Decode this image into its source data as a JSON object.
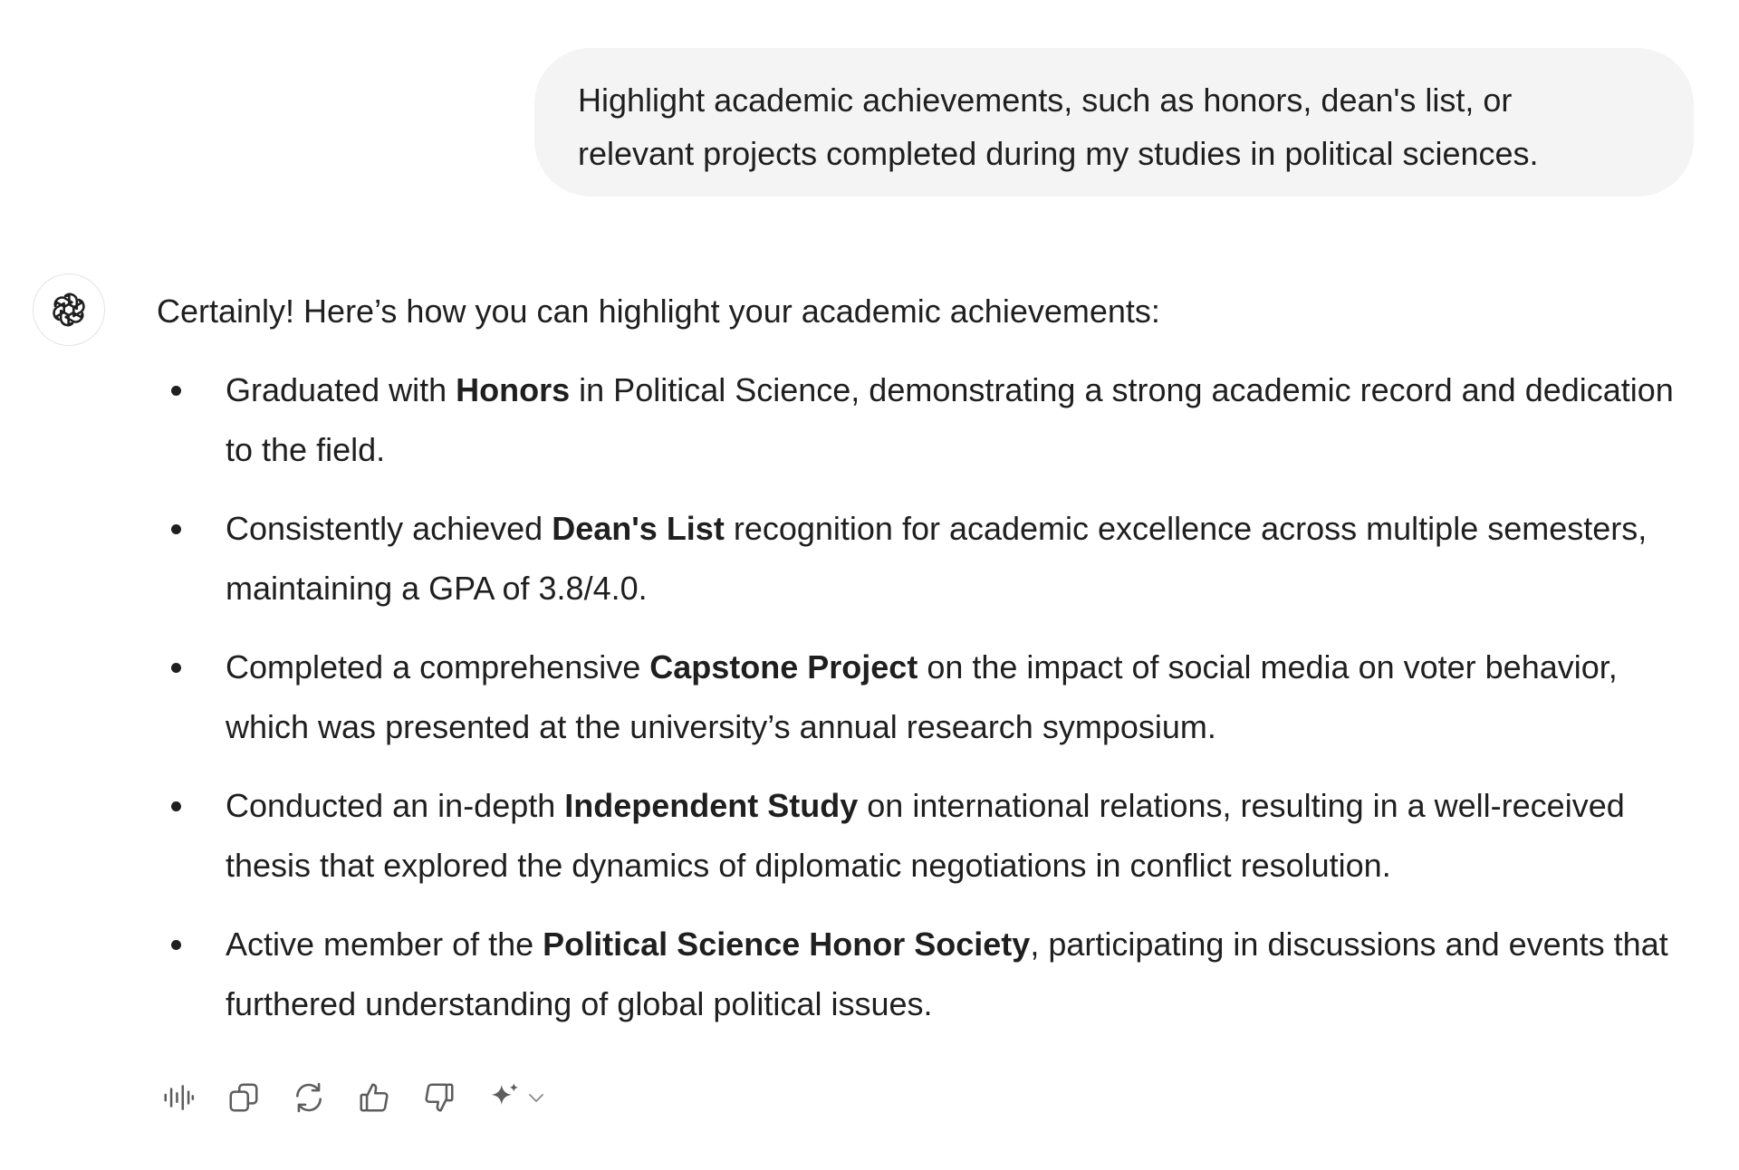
{
  "user_message": {
    "line1": "Highlight academic achievements, such as honors, dean's list, or",
    "line2": "relevant projects completed during my studies in political sciences."
  },
  "assistant": {
    "intro": "Certainly! Here’s how you can highlight your academic achievements:",
    "items": [
      {
        "before": "Graduated with ",
        "bold": "Honors",
        "after": " in Political Science, demonstrating a strong academic record and dedication to the field."
      },
      {
        "before": "Consistently achieved ",
        "bold": "Dean's List",
        "after": " recognition for academic excellence across multiple semesters, maintaining a GPA of 3.8/4.0."
      },
      {
        "before": "Completed a comprehensive ",
        "bold": "Capstone Project",
        "after": " on the impact of social media on voter behavior, which was presented at the university’s annual research symposium."
      },
      {
        "before": "Conducted an in-depth ",
        "bold": "Independent Study",
        "after": " on international relations, resulting in a well-received thesis that explored the dynamics of diplomatic negotiations in conflict resolution."
      },
      {
        "before": "Active member of the ",
        "bold": "Political Science Honor Society",
        "after": ", participating in discussions and events that furthered understanding of global political issues."
      }
    ]
  },
  "actions": {
    "icons": [
      "read-aloud-icon",
      "copy-icon",
      "regenerate-icon",
      "thumbs-up-icon",
      "thumbs-down-icon",
      "sparkle-icon",
      "chevron-down-icon"
    ]
  },
  "colors": {
    "text": "#1f1f1f",
    "bubble": "#f4f4f4",
    "icon": "#5d5d5d"
  }
}
